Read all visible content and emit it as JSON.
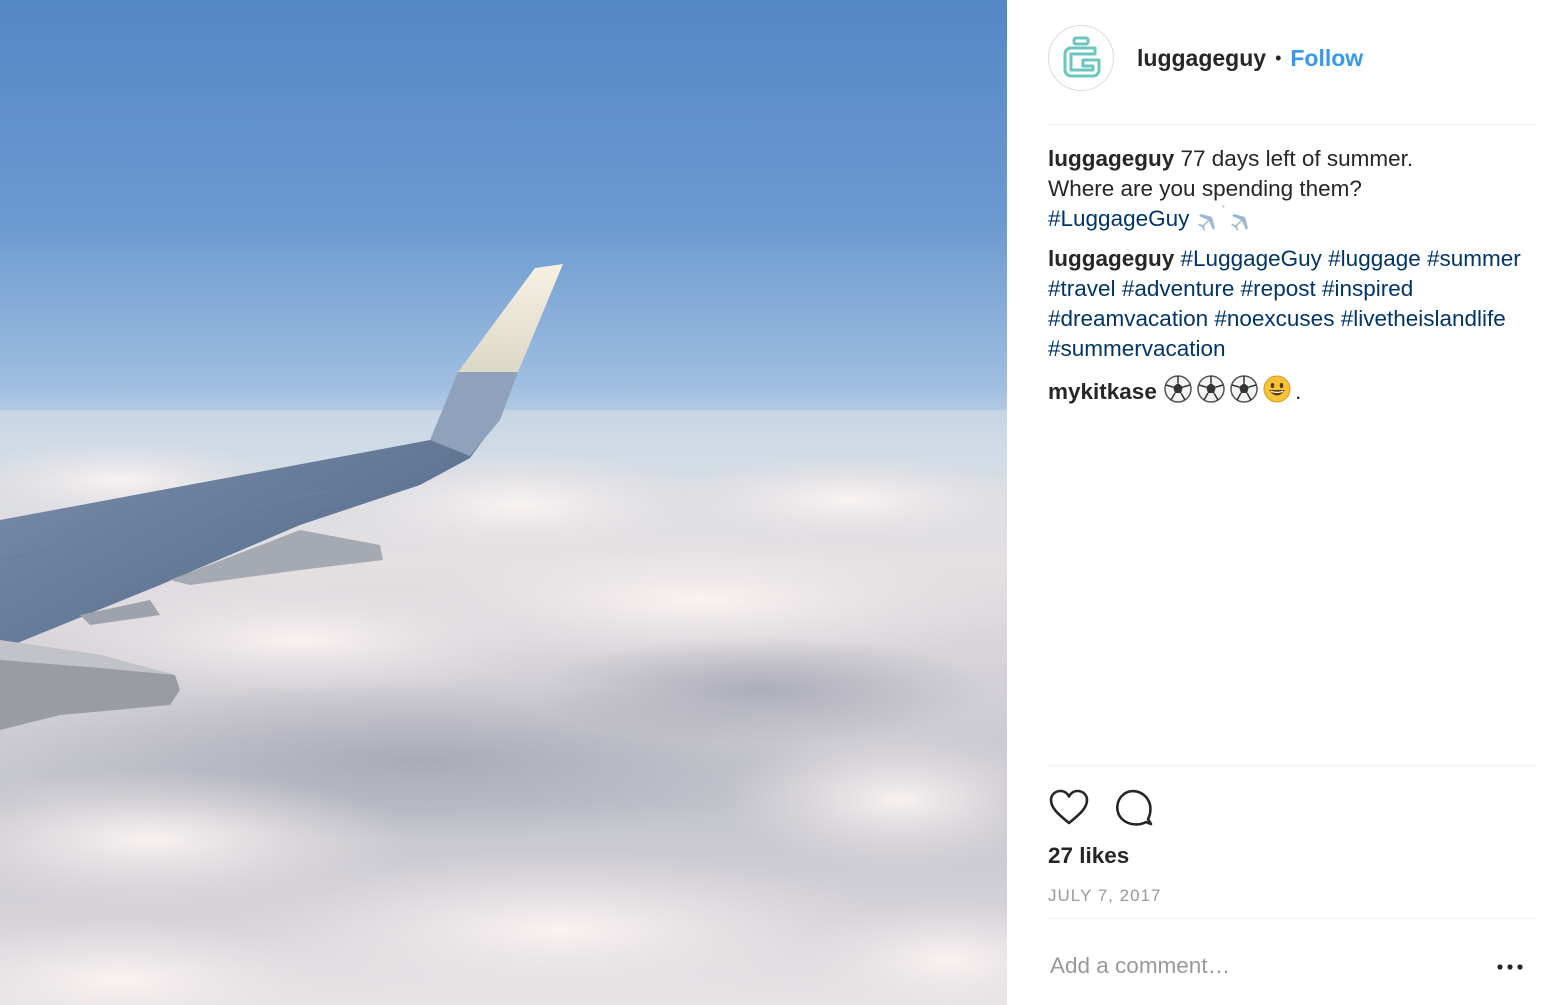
{
  "photo": {
    "icon": "airplane-wing-photo"
  },
  "header": {
    "username": "luggageguy",
    "separator": "•",
    "follow_label": "Follow",
    "avatar_icon": "luggage-g-logo",
    "accent_color": "#3897f0",
    "logo_color": "#6cc6bf"
  },
  "comments": [
    {
      "author": "luggageguy",
      "text_line1": " 77 days left of summer.",
      "text_line2": "Where are you spending them?",
      "hashtag": "#LuggageGuy",
      "trailing_emoji": [
        "airplane-icon",
        "airplane-icon"
      ]
    },
    {
      "author": "luggageguy",
      "tags": [
        "#LuggageGuy",
        "#luggage",
        "#summer",
        "#travel",
        "#adventure",
        "#repost",
        "#inspired",
        "#dreamvacation",
        "#noexcuses",
        "#livetheislandlife",
        "#summervacation"
      ]
    },
    {
      "author": "mykitkase",
      "emoji": [
        "soccer-ball-icon",
        "soccer-ball-icon",
        "soccer-ball-icon",
        "grinning-face-icon"
      ],
      "trailing": "."
    }
  ],
  "actions": {
    "like_icon": "heart-icon",
    "comment_icon": "comment-bubble-icon"
  },
  "likes": "27 likes",
  "date": "JULY 7, 2017",
  "add_comment": {
    "placeholder": "Add a comment…",
    "more_icon": "more-options-icon"
  },
  "colors": {
    "text": "#262626",
    "hashtag": "#003569",
    "muted": "#999999",
    "divider": "#efefef"
  }
}
